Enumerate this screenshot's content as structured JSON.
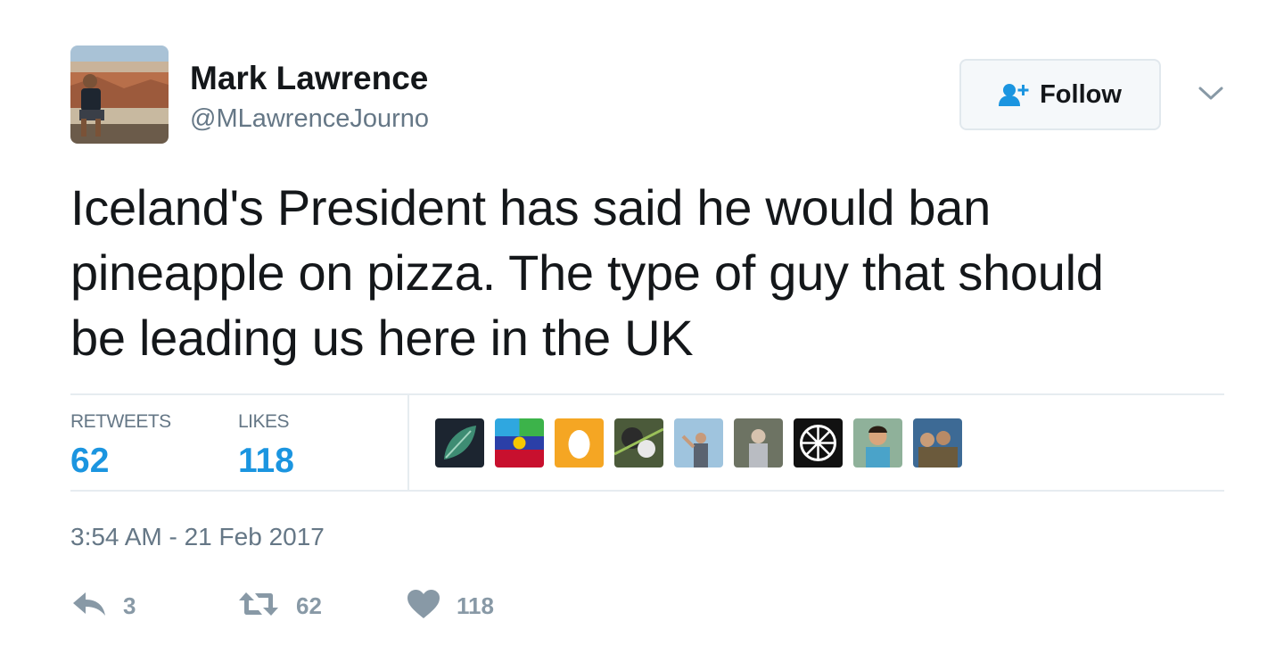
{
  "user": {
    "display_name": "Mark Lawrence",
    "handle": "@MLawrenceJourno",
    "avatar_icon": "user-avatar"
  },
  "follow_button": {
    "label": "Follow",
    "icon": "add-user-icon"
  },
  "menu": {
    "icon": "chevron-down-icon"
  },
  "tweet": {
    "text": "Iceland's President has said he would ban\npineapple on pizza. The type of guy that should\nbe leading us here in the UK"
  },
  "stats": {
    "retweets_label": "RETWEETS",
    "retweets_value": "62",
    "likes_label": "LIKES",
    "likes_value": "118"
  },
  "likers": [
    {
      "icon": "leaf-avatar"
    },
    {
      "icon": "flag-avatar"
    },
    {
      "icon": "egg-avatar"
    },
    {
      "icon": "animal-avatar"
    },
    {
      "icon": "sky-person-avatar"
    },
    {
      "icon": "portrait-avatar"
    },
    {
      "icon": "symbol-avatar"
    },
    {
      "icon": "child-avatar"
    },
    {
      "icon": "group-avatar"
    }
  ],
  "timestamp": "3:54 AM - 21 Feb 2017",
  "actions": {
    "reply_count": "3",
    "retweet_count": "62",
    "like_count": "118"
  },
  "colors": {
    "text": "#14171a",
    "secondary": "#657786",
    "accent": "#1b95e0",
    "action_grey": "#8899a6",
    "border": "#e6ecf0"
  }
}
